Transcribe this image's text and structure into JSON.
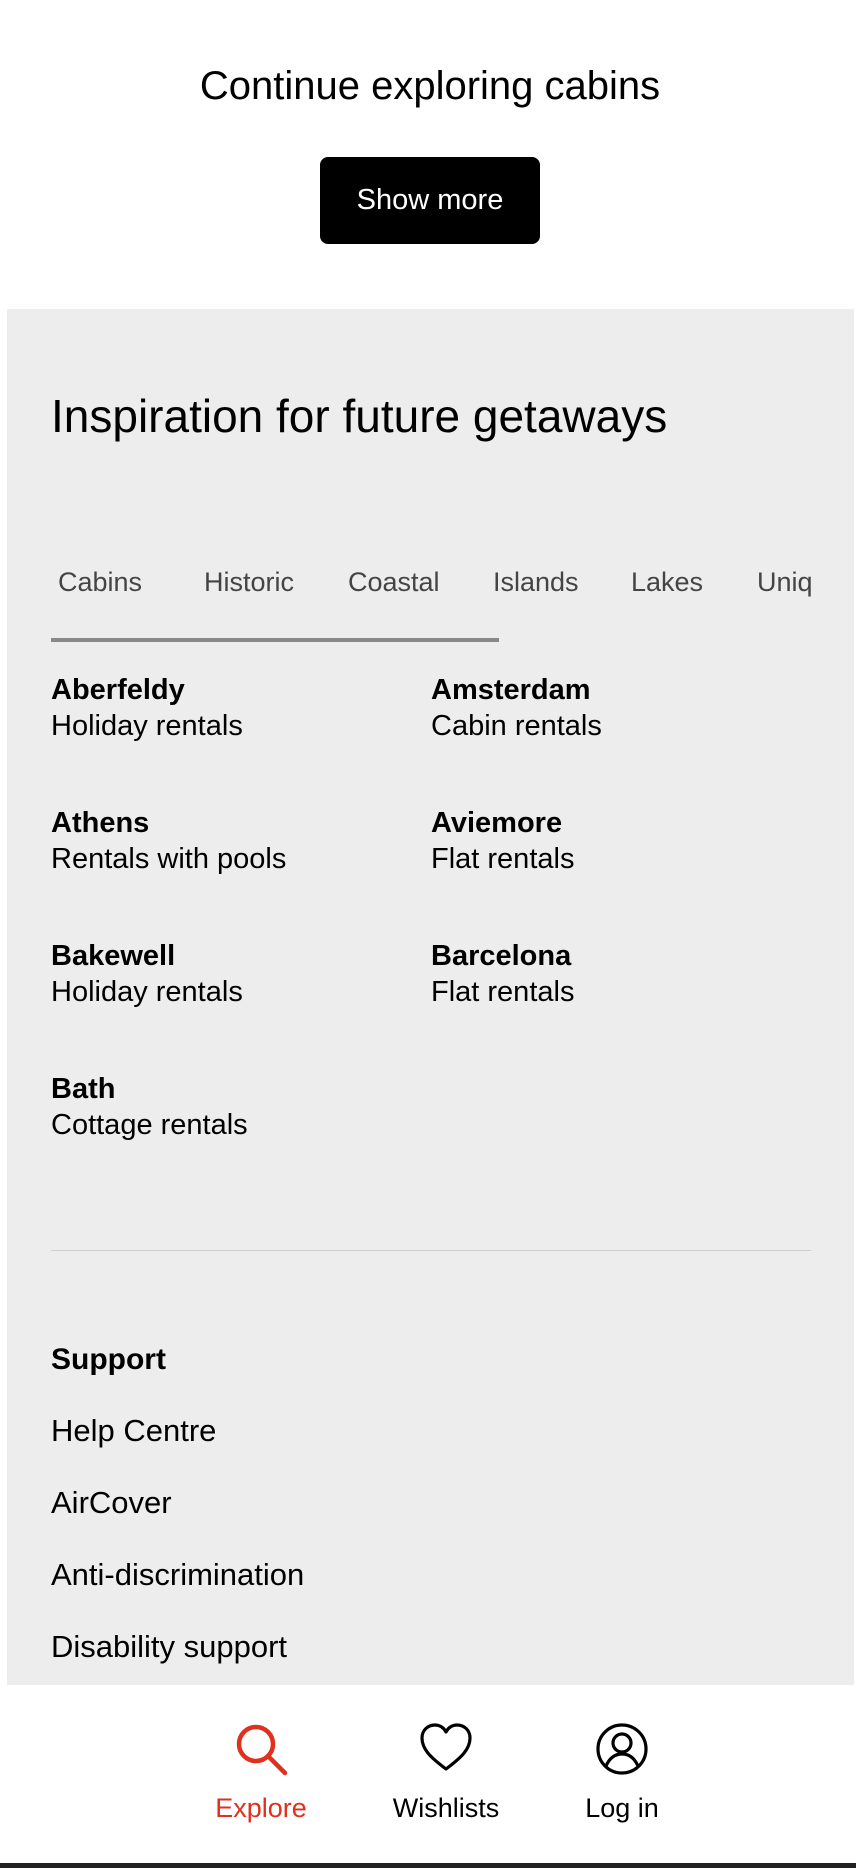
{
  "continue": {
    "title": "Continue exploring cabins",
    "show_more_label": "Show more"
  },
  "inspiration": {
    "title": "Inspiration for future getaways",
    "tabs": [
      "Cabins",
      "Historic",
      "Coastal",
      "Islands",
      "Lakes",
      "Unique"
    ],
    "active_tab": "Cabins",
    "destinations": [
      {
        "city": "Aberfeldy",
        "type": "Holiday rentals"
      },
      {
        "city": "Amsterdam",
        "type": "Cabin rentals"
      },
      {
        "city": "Athens",
        "type": "Rentals with pools"
      },
      {
        "city": "Aviemore",
        "type": "Flat rentals"
      },
      {
        "city": "Bakewell",
        "type": "Holiday rentals"
      },
      {
        "city": "Barcelona",
        "type": "Flat rentals"
      },
      {
        "city": "Bath",
        "type": "Cottage rentals"
      }
    ]
  },
  "support": {
    "title": "Support",
    "links": [
      "Help Centre",
      "AirCover",
      "Anti-discrimination",
      "Disability support"
    ]
  },
  "bottom_nav": {
    "items": [
      {
        "label": "Explore",
        "icon": "search-icon",
        "active": true
      },
      {
        "label": "Wishlists",
        "icon": "heart-icon",
        "active": false
      },
      {
        "label": "Log in",
        "icon": "user-circle-icon",
        "active": false
      }
    ],
    "active_color": "#e0301e"
  },
  "colors": {
    "panel_background": "#ededed",
    "button_background": "#000000",
    "accent": "#e0301e"
  }
}
